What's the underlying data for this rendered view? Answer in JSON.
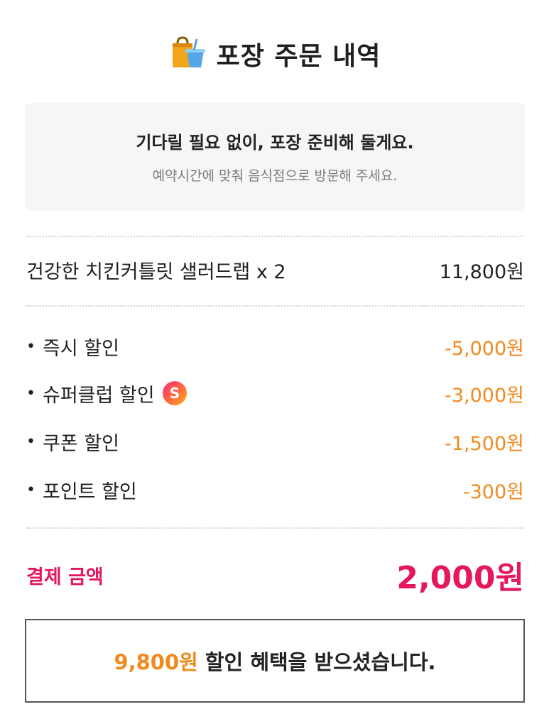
{
  "header": {
    "title": "포장 주문 내역",
    "icon": "takeout-bag-icon"
  },
  "notice": {
    "main": "기다릴 필요 없이, 포장 준비해 둘게요.",
    "sub": "예약시간에 맞춰 음식점으로 방문해 주세요."
  },
  "order": {
    "item_name": "건강한 치킨커틀릿 샐러드랩 x 2",
    "item_price": "11,800원"
  },
  "discounts": [
    {
      "label": "즉시 할인",
      "value": "-5,000원"
    },
    {
      "label": "슈퍼클럽 할인",
      "value": "-3,000원",
      "icon": "super-club-icon",
      "icon_letter": "S"
    },
    {
      "label": "쿠폰 할인",
      "value": "-1,500원"
    },
    {
      "label": "포인트 할인",
      "value": "-300원"
    }
  ],
  "bullet": "•",
  "total": {
    "label": "결제 금액",
    "value": "2,000원"
  },
  "benefit": {
    "amount": "9,800원",
    "text": "할인 혜택을 받으셨습니다."
  },
  "colors": {
    "accent_pink": "#e5175e",
    "discount_orange": "#f08a1c"
  }
}
